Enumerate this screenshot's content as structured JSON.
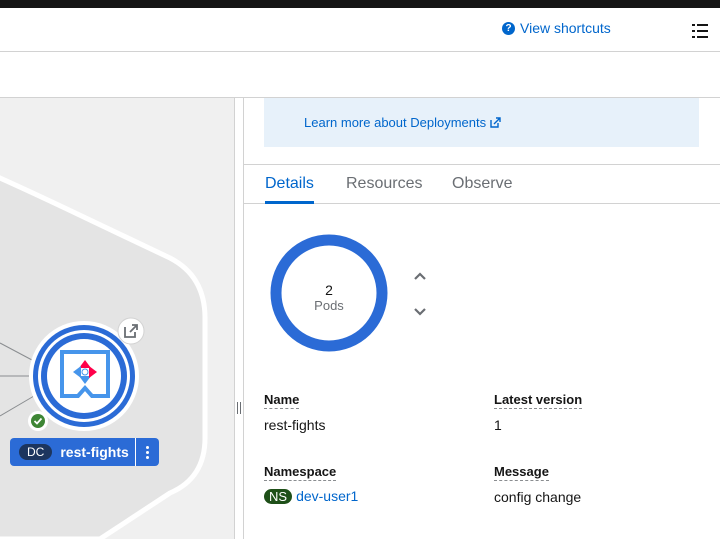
{
  "header": {
    "shortcuts_label": "View shortcuts"
  },
  "info": {
    "learn_more": "Learn more about Deployments"
  },
  "tabs": [
    {
      "label": "Details",
      "active": true
    },
    {
      "label": "Resources",
      "active": false
    },
    {
      "label": "Observe",
      "active": false
    }
  ],
  "pods": {
    "count": "2",
    "label": "Pods"
  },
  "details": {
    "name_label": "Name",
    "name_value": "rest-fights",
    "latest_version_label": "Latest version",
    "latest_version_value": "1",
    "namespace_label": "Namespace",
    "namespace_badge": "NS",
    "namespace_value": "dev-user1",
    "message_label": "Message",
    "message_value": "config change"
  },
  "node": {
    "kind_badge": "DC",
    "name": "rest-fights"
  },
  "colors": {
    "accent": "#0066cc",
    "node_blue": "#2b6bd6",
    "success": "#3e8635",
    "ns_badge": "#1e4f18"
  },
  "icons": [
    "help-circle-icon",
    "list-icon",
    "external-link-icon",
    "chevron-up-icon",
    "chevron-down-icon",
    "check-circle-icon",
    "kebab-icon",
    "quarkus-logo-icon"
  ]
}
